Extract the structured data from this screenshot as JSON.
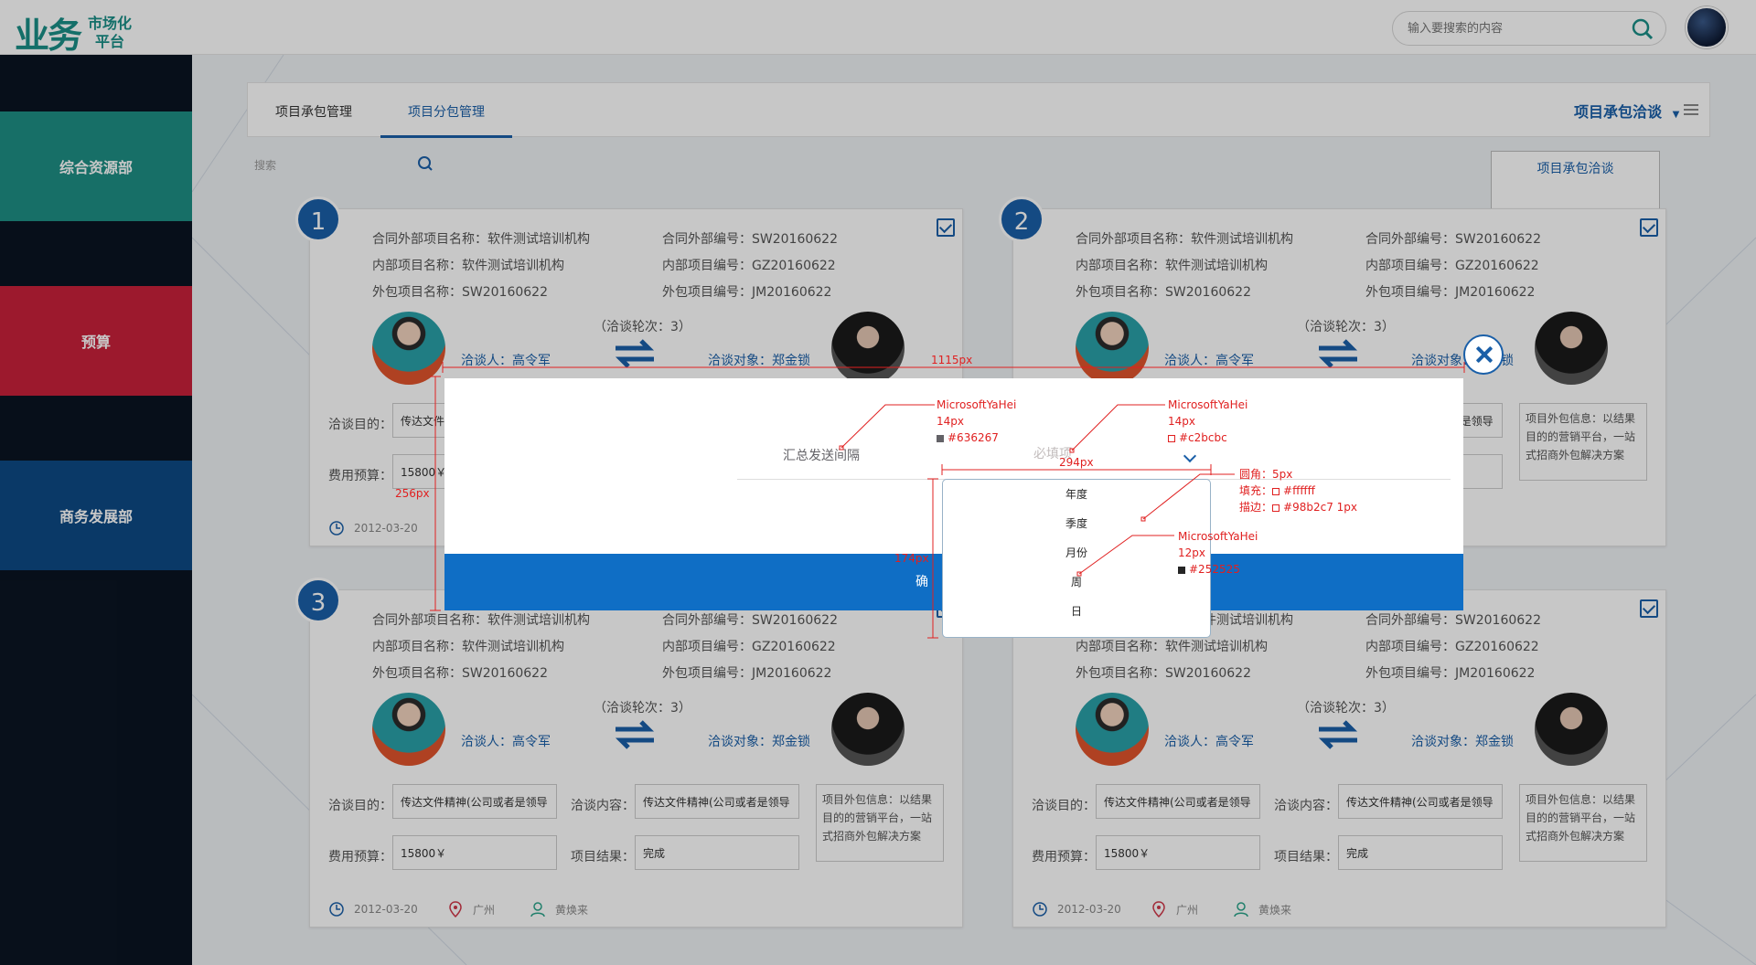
{
  "header": {
    "logo_mark": "业务",
    "logo_line1": "市场化",
    "logo_line2": "平台",
    "search_placeholder": "输入要搜索的内容"
  },
  "sidebar": {
    "items": [
      {
        "label": "综合资源部",
        "color": "#1e8f84"
      },
      {
        "label": "预算",
        "color": "#c8213a"
      },
      {
        "label": "商务发展部",
        "color": "#0e4a84"
      }
    ]
  },
  "tabs": [
    {
      "label": "项目承包管理"
    },
    {
      "label": "项目分包管理"
    }
  ],
  "toolbar": {
    "nego_label": "项目承包洽谈",
    "dropdown_item": "项目承包洽谈",
    "small_search_placeholder": "搜索"
  },
  "card_labels": {
    "contract_name_label": "合同外部项目名称：",
    "contract_no_label": "合同外部编号：",
    "internal_name_label": "内部项目名称：",
    "internal_no_label": "内部项目编号：",
    "outsource_name_label": "外包项目名称：",
    "outsource_no_label": "外包项目编号：",
    "rounds": "（洽谈轮次：3）",
    "negotiator_label": "洽谈人：",
    "negotiator": "高令军",
    "target_label": "洽谈对象：",
    "target": "郑金锁",
    "purpose_label": "洽谈目的：",
    "content_label": "洽谈内容：",
    "budget_label": "费用预算：",
    "result_label": "项目结果：",
    "purpose_value": "传达文件精神(公司或者是领导",
    "content_value": "传达文件精神(公司或者是领导",
    "budget_value": "15800￥",
    "result_value": "完成",
    "info": "项目外包信息：以结果目的的营销平台，一站式招商外包解决方案",
    "date": "2012-03-20",
    "city": "广州",
    "person": "黄焕来"
  },
  "cards": [
    {
      "num": "1",
      "contract_name": "软件测试培训机构",
      "contract_no": "SW20160622",
      "internal_name": "软件测试培训机构",
      "internal_no": "GZ20160622",
      "outsource_name": "SW20160622",
      "outsource_no": "JM20160622"
    },
    {
      "num": "2",
      "contract_name": "软件测试培训机构",
      "contract_no": "SW20160622",
      "internal_name": "软件测试培训机构",
      "internal_no": "GZ20160622",
      "outsource_name": "SW20160622",
      "outsource_no": "JM20160622"
    },
    {
      "num": "3",
      "contract_name": "软件测试培训机构",
      "contract_no": "SW20160622",
      "internal_name": "软件测试培训机构",
      "internal_no": "GZ20160622",
      "outsource_name": "SW20160622",
      "outsource_no": "JM20160622"
    },
    {
      "num": "",
      "contract_name": "软件测试培训机构",
      "contract_no": "SW20160622",
      "internal_name": "软件测试培训机构",
      "internal_no": "GZ20160622",
      "outsource_name": "SW20160622",
      "outsource_no": "JM20160622"
    }
  ],
  "modal": {
    "label": "汇总发送间隔",
    "placeholder": "必填项",
    "footer_label": "确",
    "options": [
      "年度",
      "季度",
      "月份",
      "周",
      "日"
    ]
  },
  "annotations": {
    "width_1": "1115px",
    "height_1": "256px",
    "width_2": "294px",
    "height_2": "174px",
    "font_a_name": "MicrosoftYaHei",
    "font_a_size": "14px",
    "font_a_color": "#636267",
    "font_b_name": "MicrosoftYaHei",
    "font_b_size": "14px",
    "font_b_color": "#c2bcbc",
    "radius": "圆角：5px",
    "fill": "填充：",
    "fill_color": "#ffffff",
    "stroke": "描边：",
    "stroke_value": "#98b2c7 1px",
    "font_c_name": "MicrosoftYaHei",
    "font_c_size": "12px",
    "font_c_color": "#252525"
  }
}
